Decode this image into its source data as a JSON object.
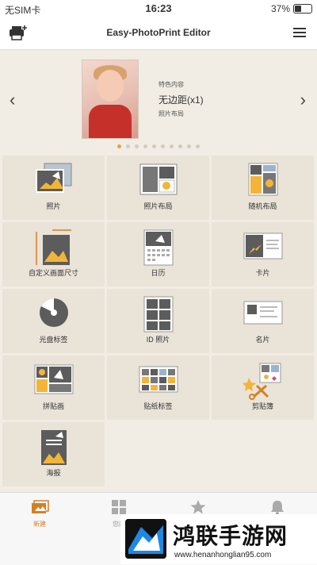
{
  "status": {
    "carrier": "无SIM卡",
    "time": "16:23",
    "battery": "37%"
  },
  "header": {
    "title": "Easy-PhotoPrint Editor",
    "printer_icon": "printer-add-icon",
    "menu_icon": "hamburger-menu-icon"
  },
  "banner": {
    "category": "特色内容",
    "main": "无边距(x1)",
    "sub": "照片布局",
    "pages": 10,
    "current_page": 1
  },
  "tiles": [
    {
      "label": "照片",
      "icon": "photo-icon"
    },
    {
      "label": "照片布局",
      "icon": "photo-layout-icon"
    },
    {
      "label": "随机布局",
      "icon": "random-layout-icon"
    },
    {
      "label": "自定义画面尺寸",
      "icon": "custom-size-icon"
    },
    {
      "label": "日历",
      "icon": "calendar-icon"
    },
    {
      "label": "卡片",
      "icon": "card-icon"
    },
    {
      "label": "光盘标签",
      "icon": "disc-label-icon"
    },
    {
      "label": "ID 照片",
      "icon": "id-photo-icon"
    },
    {
      "label": "名片",
      "icon": "business-card-icon"
    },
    {
      "label": "拼贴画",
      "icon": "collage-icon"
    },
    {
      "label": "贴纸标签",
      "icon": "sticker-icon"
    },
    {
      "label": "剪贴簿",
      "icon": "scrapbook-icon"
    },
    {
      "label": "海报",
      "icon": "poster-icon"
    }
  ],
  "tabs": [
    {
      "label": "新建",
      "icon": "new-icon",
      "active": true
    },
    {
      "label": "您的",
      "icon": "grid-icon",
      "active": false
    },
    {
      "label": "",
      "icon": "star-icon",
      "active": false
    },
    {
      "label": "",
      "icon": "bell-icon",
      "active": false
    }
  ],
  "ad": {
    "title": "鸿联手游网",
    "url": "www.henanhonglian95.com"
  },
  "colors": {
    "accent": "#e9a13b",
    "tile_bg": "#e9e3d8",
    "page_bg": "#f1ede4"
  }
}
